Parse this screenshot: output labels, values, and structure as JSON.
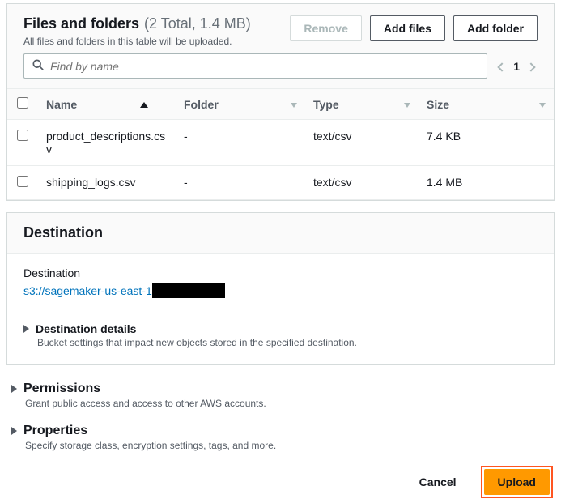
{
  "files_folders": {
    "title": "Files and folders",
    "count_text": "(2 Total, 1.4 MB)",
    "subtitle": "All files and folders in this table will be uploaded.",
    "buttons": {
      "remove": "Remove",
      "add_files": "Add files",
      "add_folder": "Add folder"
    },
    "search_placeholder": "Find by name",
    "page_number": "1",
    "columns": {
      "name": "Name",
      "folder": "Folder",
      "type": "Type",
      "size": "Size"
    },
    "rows": [
      {
        "name": "product_descriptions.csv",
        "folder": "-",
        "type": "text/csv",
        "size": "7.4 KB"
      },
      {
        "name": "shipping_logs.csv",
        "folder": "-",
        "type": "text/csv",
        "size": "1.4 MB"
      }
    ]
  },
  "destination": {
    "header": "Destination",
    "label": "Destination",
    "link": "s3://sagemaker-us-east-1",
    "details_title": "Destination details",
    "details_sub": "Bucket settings that impact new objects stored in the specified destination."
  },
  "permissions": {
    "title": "Permissions",
    "sub": "Grant public access and access to other AWS accounts."
  },
  "properties": {
    "title": "Properties",
    "sub": "Specify storage class, encryption settings, tags, and more."
  },
  "footer": {
    "cancel": "Cancel",
    "upload": "Upload"
  }
}
